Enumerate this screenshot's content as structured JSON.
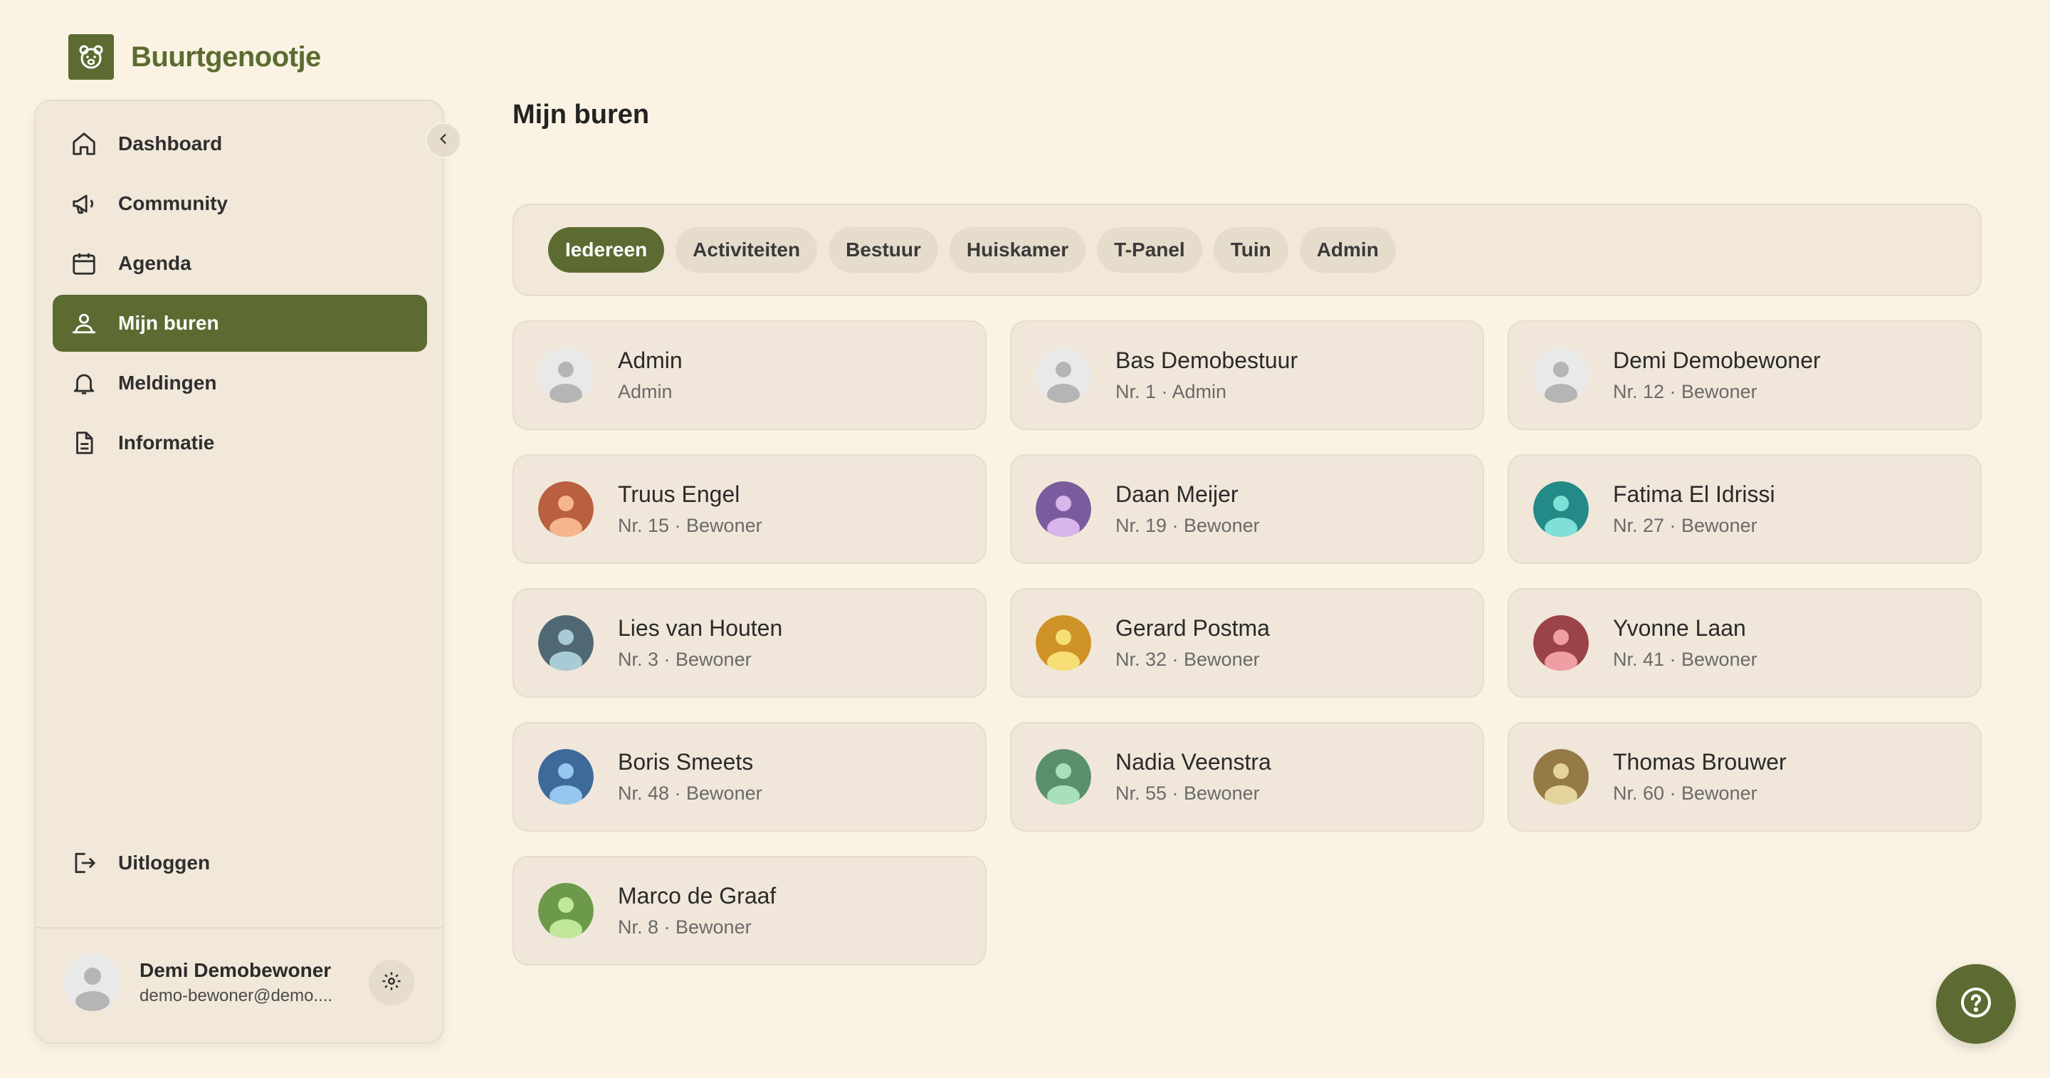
{
  "app": {
    "name": "Buurtgenootje",
    "logo_icon": "bear-icon",
    "brand_color": "#5c6b31"
  },
  "sidebar": {
    "items": [
      {
        "label": "Dashboard",
        "icon": "home-icon",
        "active": false
      },
      {
        "label": "Community",
        "icon": "megaphone-icon",
        "active": false
      },
      {
        "label": "Agenda",
        "icon": "calendar-icon",
        "active": false
      },
      {
        "label": "Mijn buren",
        "icon": "neighbors-icon",
        "active": true
      },
      {
        "label": "Meldingen",
        "icon": "bell-icon",
        "active": false
      },
      {
        "label": "Informatie",
        "icon": "document-icon",
        "active": false
      }
    ],
    "logout_label": "Uitloggen",
    "user": {
      "name": "Demi Demobewoner",
      "email": "demo-bewoner@demo...."
    }
  },
  "main": {
    "title": "Mijn buren",
    "filters": [
      "Iedereen",
      "Activiteiten",
      "Bestuur",
      "Huiskamer",
      "T-Panel",
      "Tuin",
      "Admin"
    ],
    "active_filter": "Iedereen",
    "neighbors": [
      {
        "name": "Admin",
        "detail": "Admin",
        "color": "#e9e9e9",
        "light": "#b5b5b5"
      },
      {
        "name": "Bas Demobestuur",
        "detail": "Nr. 1 · Admin",
        "color": "#e9e9e9",
        "light": "#b5b5b5"
      },
      {
        "name": "Demi Demobewoner",
        "detail": "Nr. 12 · Bewoner",
        "color": "#e9e9e9",
        "light": "#b5b5b5"
      },
      {
        "name": "Truus Engel",
        "detail": "Nr. 15 · Bewoner",
        "color": "#b8603f",
        "light": "#f5b58f"
      },
      {
        "name": "Daan Meijer",
        "detail": "Nr. 19 · Bewoner",
        "color": "#7a5c9e",
        "light": "#d8b6ec"
      },
      {
        "name": "Fatima El Idrissi",
        "detail": "Nr. 27 · Bewoner",
        "color": "#238a87",
        "light": "#7fe0d8"
      },
      {
        "name": "Lies van Houten",
        "detail": "Nr. 3 · Bewoner",
        "color": "#4f6874",
        "light": "#a9cbd6"
      },
      {
        "name": "Gerard Postma",
        "detail": "Nr. 32 · Bewoner",
        "color": "#cf9226",
        "light": "#f7dd75"
      },
      {
        "name": "Yvonne Laan",
        "detail": "Nr. 41 · Bewoner",
        "color": "#9a4348",
        "light": "#ef9ea3"
      },
      {
        "name": "Boris Smeets",
        "detail": "Nr. 48 · Bewoner",
        "color": "#3e6a9a",
        "light": "#96c8ef"
      },
      {
        "name": "Nadia Veenstra",
        "detail": "Nr. 55 · Bewoner",
        "color": "#5a8f6c",
        "light": "#a9dfbb"
      },
      {
        "name": "Thomas Brouwer",
        "detail": "Nr. 60 · Bewoner",
        "color": "#947b45",
        "light": "#e5d39c"
      },
      {
        "name": "Marco de Graaf",
        "detail": "Nr. 8 · Bewoner",
        "color": "#6c9a4a",
        "light": "#c1e89a"
      }
    ]
  },
  "help": {
    "icon": "help-icon"
  }
}
